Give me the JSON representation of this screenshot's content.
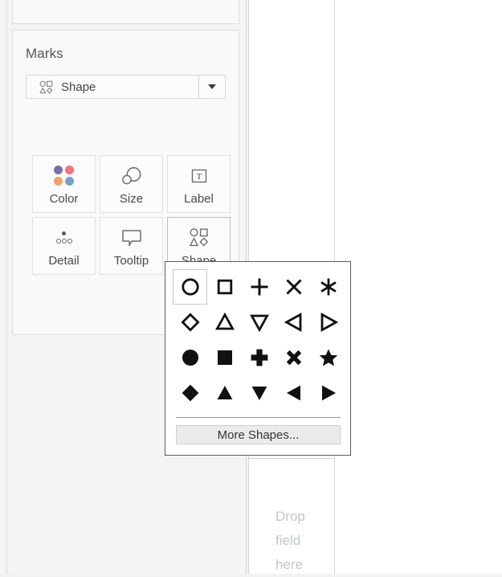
{
  "marks_card": {
    "title": "Marks",
    "mark_type": {
      "label": "Shape",
      "icon": "shapes-icon",
      "dropdown_icon": "chevron-down-icon"
    },
    "buttons": [
      {
        "label": "Color",
        "icon": "color-dots-icon",
        "active": false
      },
      {
        "label": "Size",
        "icon": "size-circles-icon",
        "active": false
      },
      {
        "label": "Label",
        "icon": "label-text-icon",
        "active": false
      },
      {
        "label": "Detail",
        "icon": "detail-dots-icon",
        "active": false
      },
      {
        "label": "Tooltip",
        "icon": "tooltip-bubble-icon",
        "active": false
      },
      {
        "label": "Shape",
        "icon": "shapes-icon",
        "active": true
      }
    ],
    "color_swatches": {
      "purple": "#7b6fa8",
      "pink": "#f2737a",
      "orange": "#f0a06a",
      "blue": "#7b9ec8"
    }
  },
  "shape_palette": {
    "selected_shape": "circle-open",
    "shapes": [
      {
        "name": "circle-open",
        "row": 1
      },
      {
        "name": "square-open",
        "row": 1
      },
      {
        "name": "plus-thin",
        "row": 1
      },
      {
        "name": "cross-x-thin",
        "row": 1
      },
      {
        "name": "asterisk",
        "row": 1
      },
      {
        "name": "diamond-open",
        "row": 2
      },
      {
        "name": "triangle-up-open",
        "row": 2
      },
      {
        "name": "triangle-down-open",
        "row": 2
      },
      {
        "name": "triangle-left-open",
        "row": 2
      },
      {
        "name": "triangle-right-open",
        "row": 2
      },
      {
        "name": "circle-filled",
        "row": 3
      },
      {
        "name": "square-filled",
        "row": 3
      },
      {
        "name": "plus-bold",
        "row": 3
      },
      {
        "name": "cross-x-bold",
        "row": 3
      },
      {
        "name": "star-filled",
        "row": 3
      },
      {
        "name": "diamond-filled",
        "row": 4
      },
      {
        "name": "triangle-up-filled",
        "row": 4
      },
      {
        "name": "triangle-down-filled",
        "row": 4
      },
      {
        "name": "triangle-left-filled",
        "row": 4
      },
      {
        "name": "triangle-right-filled",
        "row": 4
      }
    ],
    "more_shapes_label": "More Shapes..."
  },
  "view": {
    "drop_target": {
      "line1": "Drop",
      "line2": "field",
      "line3": "here"
    }
  }
}
